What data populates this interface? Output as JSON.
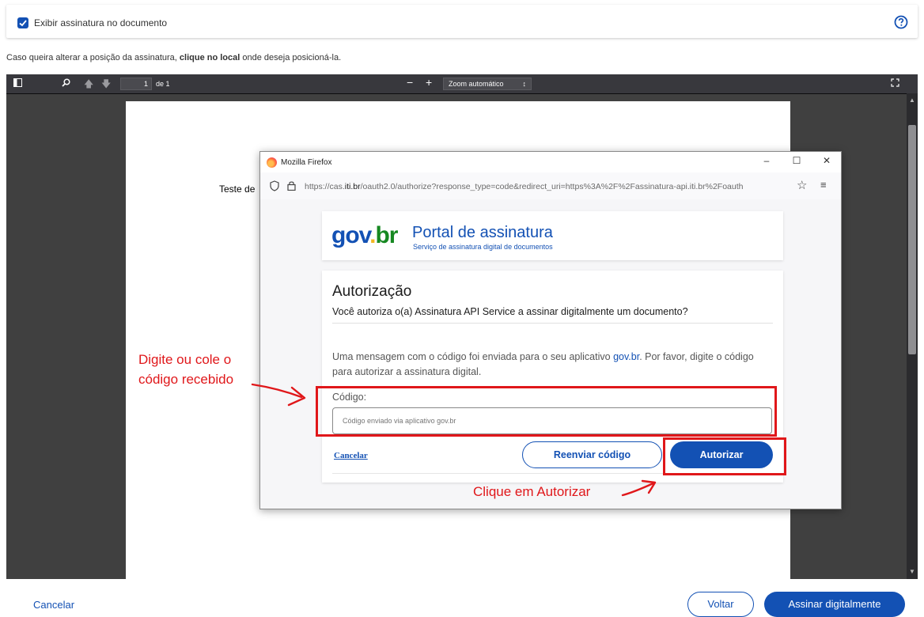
{
  "top": {
    "checkbox_label": "Exibir assinatura no documento",
    "checked": true
  },
  "instruction": {
    "before": "Caso queira alterar a posição da assinatura, ",
    "bold": "clique no local",
    "after": " onde deseja posicioná-la."
  },
  "viewer": {
    "page_number": "1",
    "page_of": "de 1",
    "zoom_label": "Zoom automático",
    "page_text": "Teste de"
  },
  "popup": {
    "window_title": "Mozilla Firefox",
    "url_prefix": "https://cas.",
    "url_domain": "iti.br",
    "url_rest": "/oauth2.0/authorize?response_type=code&redirect_uri=https%3A%2F%2Fassinatura-api.iti.br%2Foauth",
    "brand": {
      "logo_part1": "gov",
      "logo_dot": ".",
      "logo_part2": "br",
      "title": "Portal de assinatura",
      "subtitle": "Serviço de assinatura digital de documentos"
    },
    "auth": {
      "title": "Autorização",
      "question": "Você autoriza o(a) Assinatura API Service a assinar digitalmente um documento?",
      "message_before": "Uma mensagem com o código foi enviada para o seu aplicativo ",
      "message_link": "gov.br",
      "message_after": ". Por favor, digite o código para autorizar a assinatura digital.",
      "code_label": "Código:",
      "code_placeholder": "Código enviado via aplicativo gov.br",
      "code_value": "",
      "cancel_label": "Cancelar",
      "resend_label": "Reenviar código",
      "authorize_label": "Autorizar"
    }
  },
  "annotations": {
    "code_hint_line1": "Digite ou cole o",
    "code_hint_line2": "código recebido",
    "button_hint": "Clique em Autorizar",
    "color": "#e0171a"
  },
  "bottom": {
    "cancel_label": "Cancelar",
    "back_label": "Voltar",
    "sign_label": "Assinar digitalmente"
  },
  "colors": {
    "primary": "#1351b4",
    "annotation": "#e0171a"
  }
}
